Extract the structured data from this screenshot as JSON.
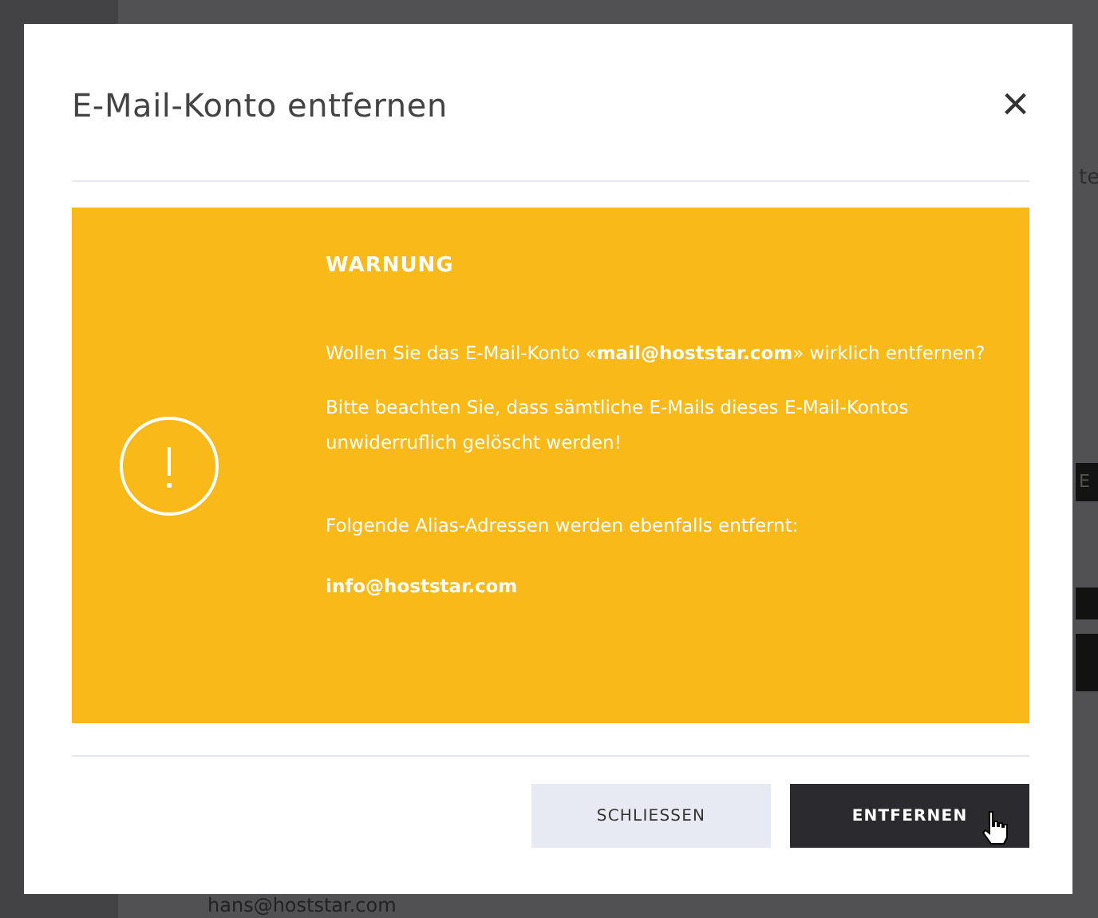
{
  "background": {
    "fragments": [
      {
        "kind": "text",
        "text": "te"
      },
      {
        "kind": "button",
        "text": "E"
      },
      {
        "kind": "text",
        "text": "hans@hoststar.com"
      }
    ]
  },
  "dialog": {
    "title": "E-Mail-Konto entfernen",
    "close": "×",
    "warning": {
      "heading": "WARNUNG",
      "paragraphs": [
        "Wollen Sie das E-Mail-Konto «**mail@hoststar.com**» wirklich entfernen?",
        "Bitte beachten Sie, dass sämtliche E-Mails dieses E-Mail-Kontos unwiderruflich gelöscht werden!"
      ],
      "alias_intro": "Folgende Alias-Adressen werden ebenfalls entfernt:",
      "aliases": [
        "info@hoststar.com"
      ]
    },
    "buttons": [
      {
        "label": "SCHLIESSEN",
        "kind": "secondary",
        "hovered": false
      },
      {
        "label": "ENTFERNEN",
        "kind": "primary",
        "hovered": true
      }
    ]
  }
}
